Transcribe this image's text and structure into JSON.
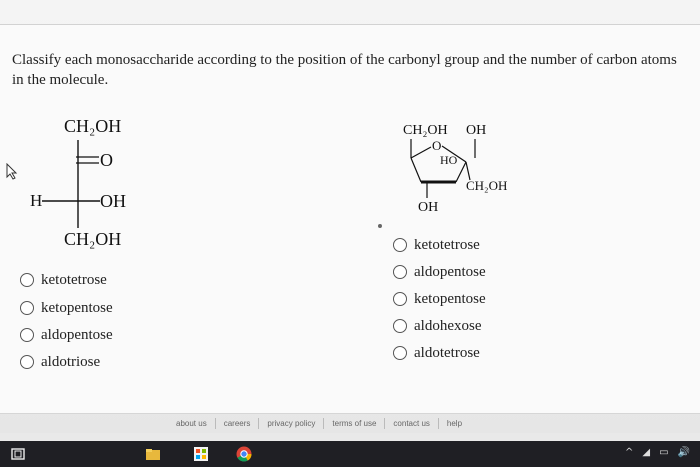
{
  "question": {
    "text": "Classify each monosaccharide according to the position of the carbonyl group and the number of carbon atoms in the molecule."
  },
  "left_structure": {
    "top_group": "CH₂OH",
    "carbonyl": "O",
    "left_sub": "H",
    "right_sub": "OH",
    "bottom_group": "CH₂OH"
  },
  "right_structure": {
    "top_left": "CH₂OH",
    "top_right": "OH",
    "ring_oxygen": "O",
    "ring_ho": "HO",
    "right_group": "CH₂OH",
    "bottom": "OH"
  },
  "left_options": [
    "ketotetrose",
    "ketopentose",
    "aldopentose",
    "aldotriose"
  ],
  "right_options": [
    "ketotetrose",
    "aldopentose",
    "ketopentose",
    "aldohexose",
    "aldotetrose"
  ],
  "footer_links": [
    "about us",
    "careers",
    "privacy policy",
    "terms of use",
    "contact us",
    "help"
  ],
  "taskbar": {
    "tray_icon": "volume-icon"
  }
}
